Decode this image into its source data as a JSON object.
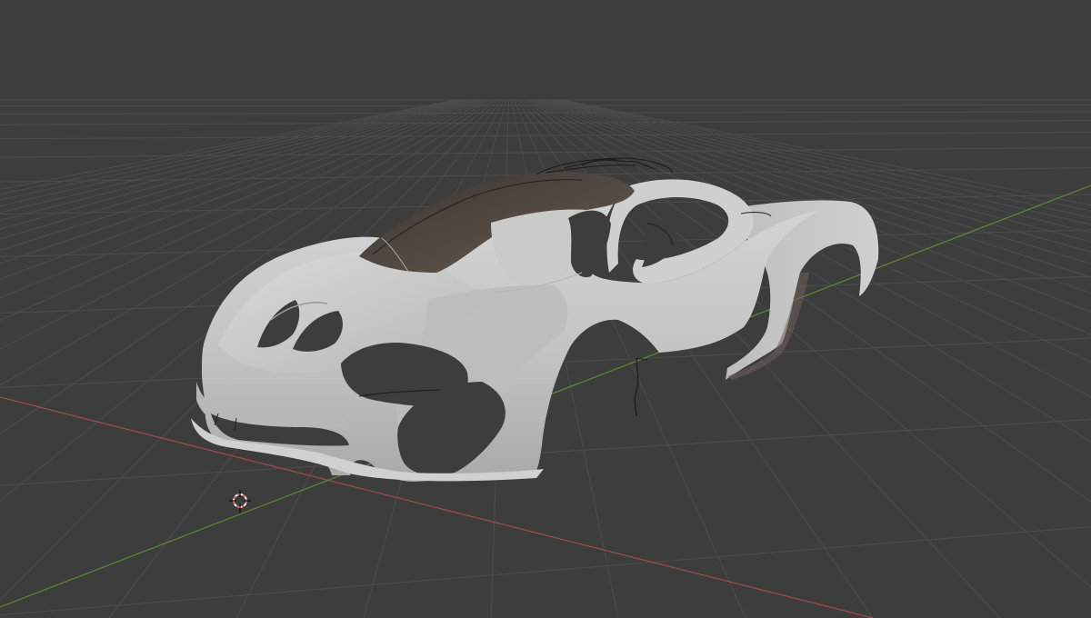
{
  "app": {
    "type": "3d-viewport"
  },
  "viewport": {
    "background_color": "#3d3d3d",
    "grid_line_color": "#4c4c4c",
    "grid_major_color": "#545454",
    "x_axis_color": "#a44b4b",
    "y_axis_color": "#5d8a36",
    "model_body_color": "#c9c9c9",
    "model_shadow_color": "#a2a2a2",
    "model_dark_color": "#3e3a37",
    "canopy_color": "#5b4e45",
    "outline_color": "#1e1e1e",
    "cursor_color_a": "#e46a6a",
    "cursor_color_b": "#f2f2f2",
    "objects": [
      {
        "name": "car-body-mesh",
        "icon": "mesh-object"
      },
      {
        "name": "3d-cursor",
        "icon": "3d-cursor-icon"
      }
    ]
  }
}
